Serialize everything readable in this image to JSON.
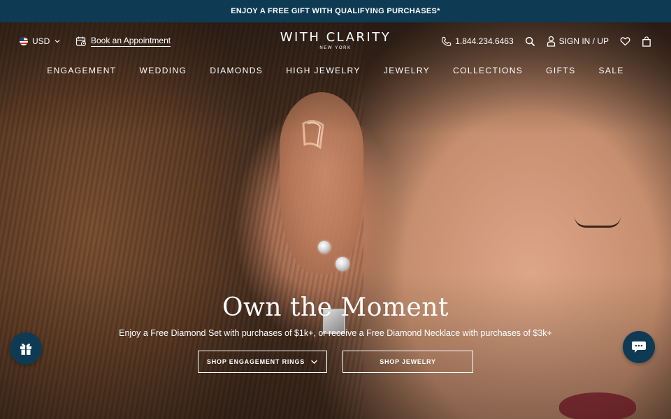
{
  "announcement": {
    "text": "ENJOY A FREE GIFT WITH QUALIFYING PURCHASES*"
  },
  "header": {
    "currency": "USD",
    "appointment_label": "Book an Appointment",
    "logo_main": "WITH CLARITY",
    "logo_sub": "NEW YORK",
    "phone": "1.844.234.6463",
    "signin_label": "SIGN IN / UP"
  },
  "nav": {
    "items": [
      "ENGAGEMENT",
      "WEDDING",
      "DIAMONDS",
      "HIGH JEWELRY",
      "JEWELRY",
      "COLLECTIONS",
      "GIFTS",
      "SALE"
    ]
  },
  "hero": {
    "headline": "Own the Moment",
    "subline": "Enjoy a Free Diamond Set with purchases of $1k+, or receive a Free Diamond Necklace with purchases of $3k+",
    "cta_primary": "SHOP ENGAGEMENT RINGS",
    "cta_secondary": "SHOP JEWELRY"
  },
  "colors": {
    "brand_navy": "#0f3a53",
    "text": "#ffffff"
  },
  "icons": [
    "flag-us-icon",
    "chevron-down-icon",
    "calendar-icon",
    "phone-icon",
    "search-icon",
    "user-icon",
    "heart-icon",
    "bag-icon",
    "gift-icon",
    "chat-icon"
  ]
}
